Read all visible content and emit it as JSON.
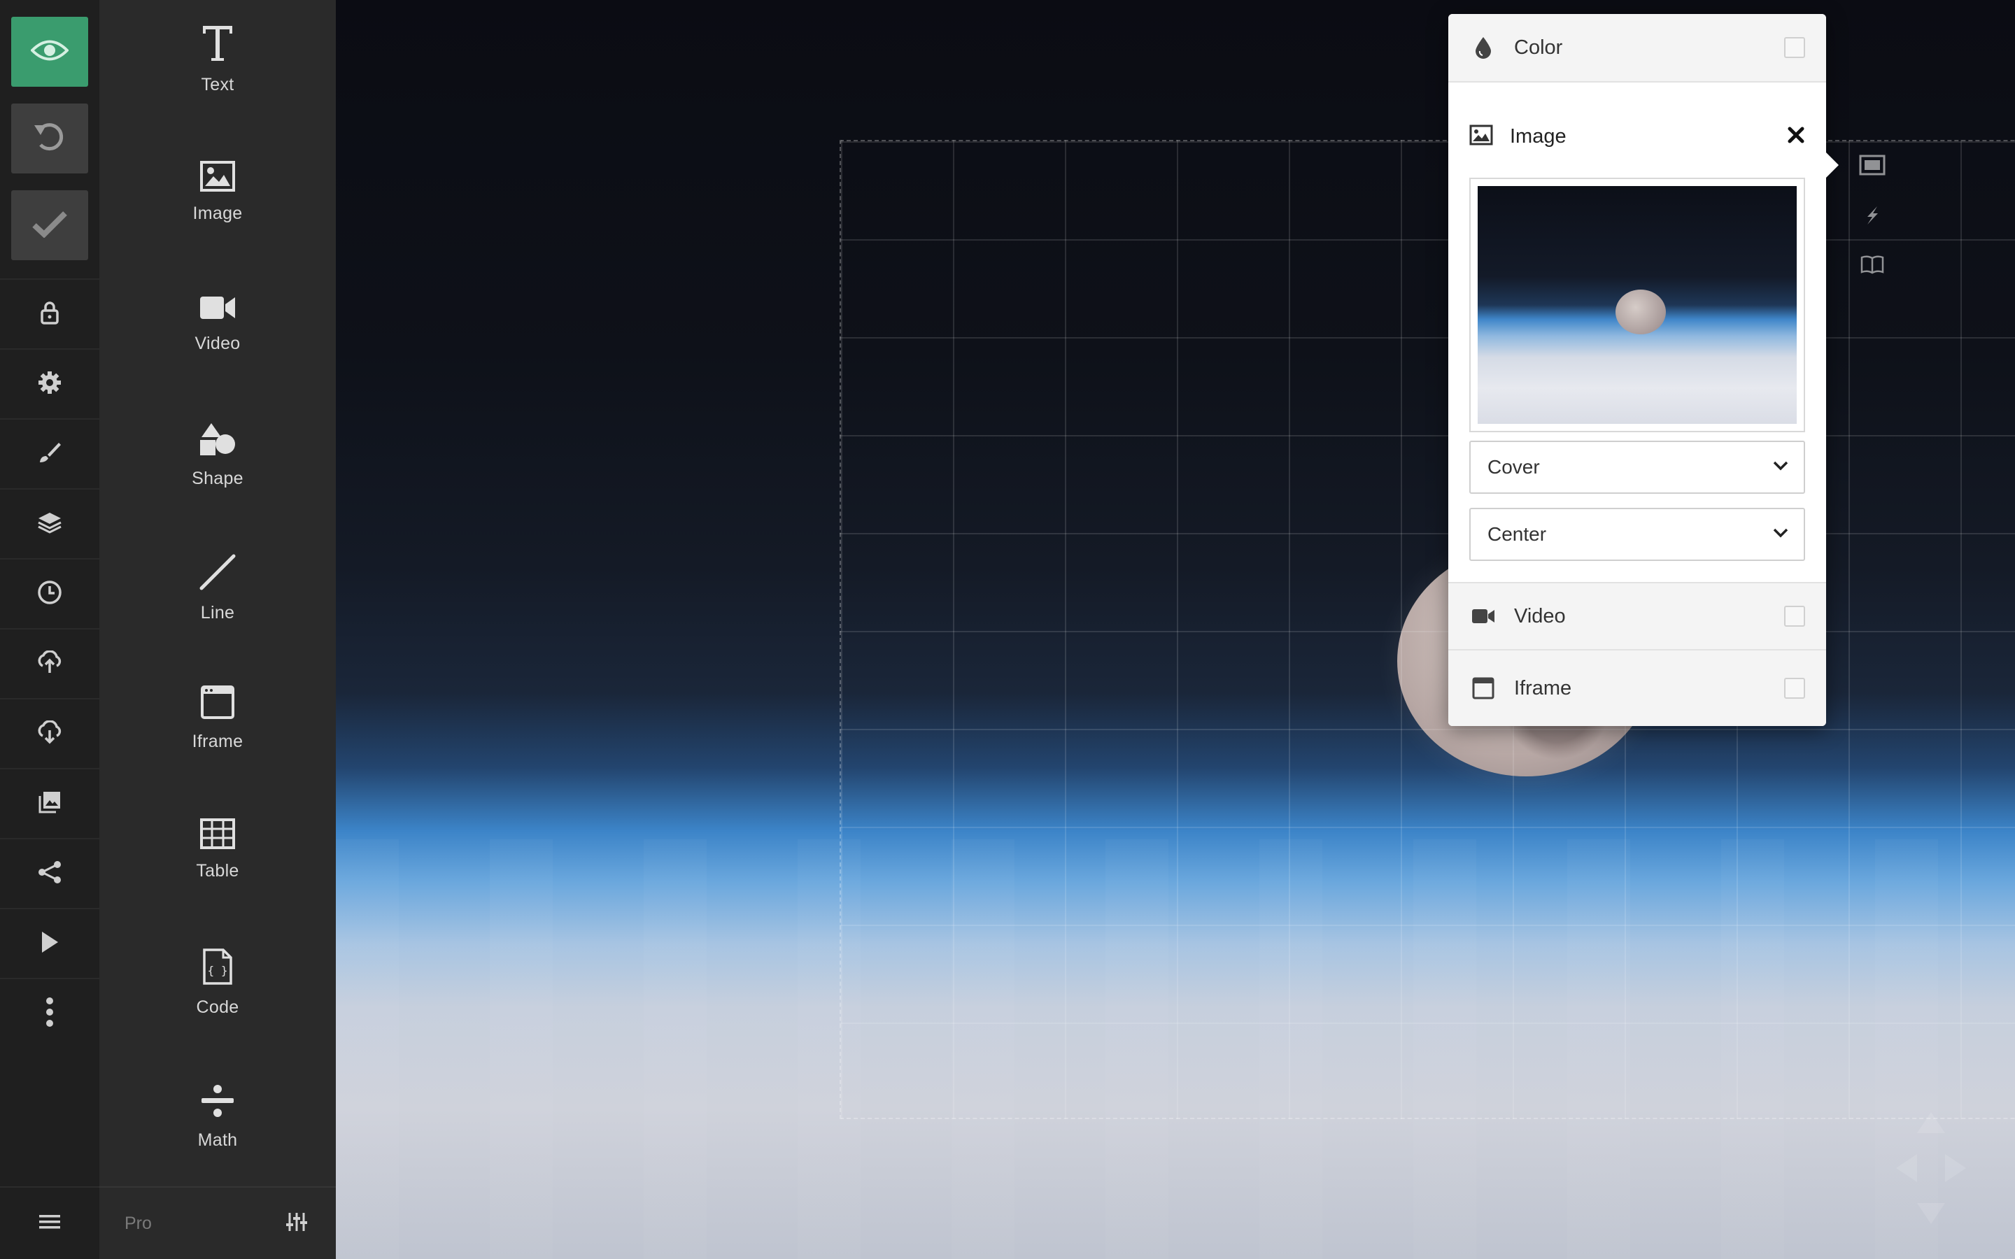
{
  "rail": {
    "preview": "eye-icon",
    "undo": "undo-icon",
    "done": "check-icon",
    "items": [
      "lock-icon",
      "gear-icon",
      "brush-icon",
      "layers-icon",
      "clock-icon",
      "cloud-upload-icon",
      "cloud-download-icon",
      "gallery-icon",
      "share-icon",
      "play-icon",
      "more-vertical-icon"
    ],
    "menu": "hamburger-icon"
  },
  "palette": {
    "blocks": [
      {
        "label": "Text",
        "icon": "text-icon"
      },
      {
        "label": "Image",
        "icon": "image-icon"
      },
      {
        "label": "Video",
        "icon": "video-icon"
      },
      {
        "label": "Shape",
        "icon": "shape-icon"
      },
      {
        "label": "Line",
        "icon": "line-icon"
      },
      {
        "label": "Iframe",
        "icon": "iframe-icon"
      },
      {
        "label": "Table",
        "icon": "table-icon"
      },
      {
        "label": "Code",
        "icon": "code-icon"
      },
      {
        "label": "Math",
        "icon": "math-icon"
      }
    ],
    "footer": {
      "label": "Pro",
      "settings_icon": "sliders-icon"
    }
  },
  "background_panel": {
    "color_label": "Color",
    "image_label": "Image",
    "size_value": "Cover",
    "position_value": "Center",
    "video_label": "Video",
    "iframe_label": "Iframe"
  },
  "colors": {
    "accent": "#3a9c6e",
    "rail_bg": "#1f1f1f",
    "palette_bg": "#2a2a2a",
    "panel_bg": "#ffffff"
  }
}
